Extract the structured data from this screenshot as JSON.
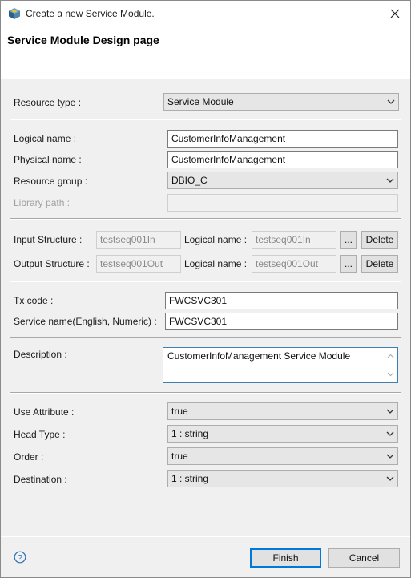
{
  "window": {
    "title": "Create a new Service Module.",
    "header_title": "Service Module Design page"
  },
  "resource_type": {
    "label": "Resource type :",
    "value": "Service Module"
  },
  "logical_name": {
    "label": "Logical name :",
    "value": "CustomerInfoManagement"
  },
  "physical_name": {
    "label": "Physical name :",
    "value": "CustomerInfoManagement"
  },
  "resource_group": {
    "label": "Resource group :",
    "value": "DBIO_C"
  },
  "library_path": {
    "label": "Library path :",
    "value": ""
  },
  "input_structure": {
    "label": "Input Structure :",
    "value": "testseq001In",
    "logical_label": "Logical name :",
    "logical_value": "testseq001In",
    "browse_label": "...",
    "delete_label": "Delete"
  },
  "output_structure": {
    "label": "Output Structure :",
    "value": "testseq001Out",
    "logical_label": "Logical name :",
    "logical_value": "testseq001Out",
    "browse_label": "...",
    "delete_label": "Delete"
  },
  "tx_code": {
    "label": "Tx code :",
    "value": "FWCSVC301"
  },
  "service_name": {
    "label": "Service name(English, Numeric) :",
    "value": "FWCSVC301"
  },
  "description": {
    "label": "Description :",
    "value": "CustomerInfoManagement Service Module"
  },
  "use_attribute": {
    "label": "Use Attribute :",
    "value": "true"
  },
  "head_type": {
    "label": "Head Type :",
    "value": "1 : string"
  },
  "order": {
    "label": "Order :",
    "value": "true"
  },
  "destination": {
    "label": "Destination :",
    "value": "1 : string"
  },
  "footer": {
    "finish_label": "Finish",
    "cancel_label": "Cancel"
  },
  "icons": [
    "app-icon",
    "close-icon",
    "chevron-down-icon",
    "help-icon"
  ],
  "colors": {
    "accent": "#0078d7",
    "focus_border": "#3c7fb1"
  }
}
